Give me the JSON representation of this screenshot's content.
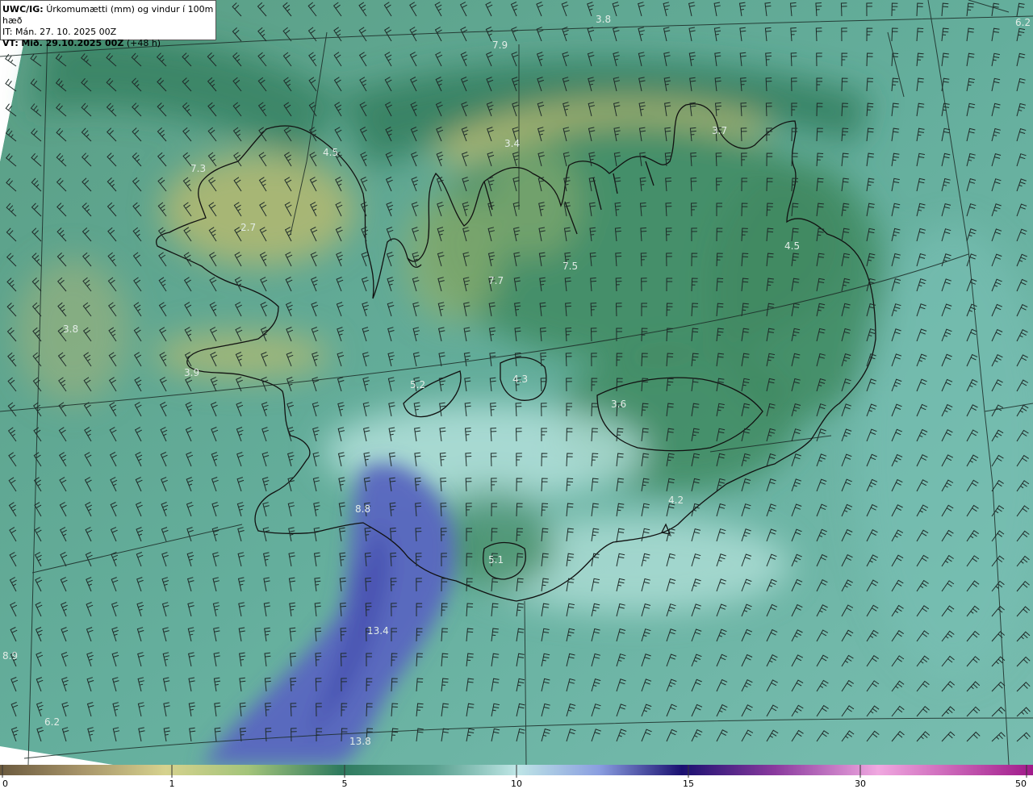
{
  "header": {
    "product": "UWC/IG:",
    "title": "Úrkomumætti (mm) og vindur í 100m hæð",
    "it_label": "IT:",
    "it_value": "Mán. 27. 10. 2025 00Z",
    "vt_label": "VT:",
    "vt_value": "Mið. 29.10.2025 00Z",
    "vt_offset": "(+48 h)"
  },
  "value_labels": [
    "3.8",
    "6.2",
    "7.9",
    "3.4",
    "3.7",
    "7.3",
    "4.5",
    "2.7",
    "4.5",
    "7.5",
    "7.7",
    "3.8",
    "4.3",
    "5.2",
    "3.6",
    "4.2",
    "8.8",
    "5.1",
    "13.4",
    "8.9",
    "6.2",
    "13.8",
    "3.9"
  ],
  "colorbar": {
    "ticks": [
      "0",
      "1",
      "5",
      "10",
      "15",
      "30",
      "50"
    ],
    "tick_values": [
      0,
      1,
      5,
      10,
      15,
      30,
      50
    ],
    "colors": [
      "#6b5a3e",
      "#a8956a",
      "#d6d28e",
      "#a3c47a",
      "#5e9e7a",
      "#2e7a5e",
      "#58a08e",
      "#8cc8be",
      "#bfe6e6",
      "#8a9ee0",
      "#3c4aa8",
      "#1a1070",
      "#8a3a9e",
      "#d070c0",
      "#f0a8e0",
      "#a01a8a"
    ]
  },
  "colors": {
    "land_green": "#3f8a62",
    "sea_teal": "#66ada0",
    "dry_yellow": "#b9ba6e",
    "wet_blue": "#5a66c0",
    "light_cyan": "#b8e4de",
    "barb": "#1e2a28",
    "coast": "#111111"
  }
}
